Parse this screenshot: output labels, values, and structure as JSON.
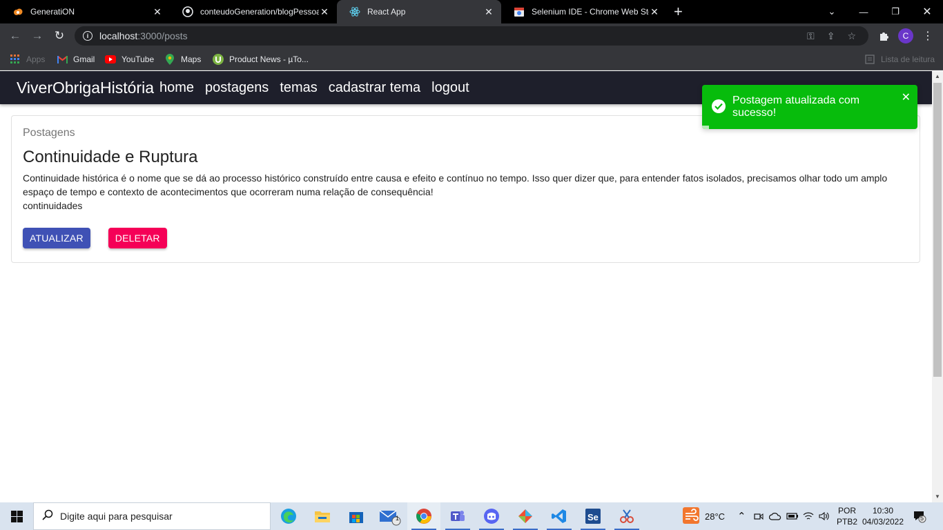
{
  "browser": {
    "tabs": [
      {
        "title": "GeneratiON",
        "favicon": "cloud-icon",
        "active": false
      },
      {
        "title": "conteudoGeneration/blogPessoal",
        "favicon": "github-icon",
        "active": false
      },
      {
        "title": "React App",
        "favicon": "react-icon",
        "active": true
      },
      {
        "title": "Selenium IDE - Chrome Web Store",
        "favicon": "webstore-icon",
        "active": false
      }
    ],
    "url_host": "localhost",
    "url_path": ":3000/posts",
    "profile_initial": "C",
    "bookmarks": [
      {
        "label": "Apps",
        "icon": "apps-grid-icon"
      },
      {
        "label": "Gmail",
        "icon": "gmail-icon"
      },
      {
        "label": "YouTube",
        "icon": "youtube-icon"
      },
      {
        "label": "Maps",
        "icon": "maps-icon"
      },
      {
        "label": "Product News - µTo...",
        "icon": "utorrent-icon"
      }
    ],
    "reading_list": "Lista de leitura"
  },
  "app": {
    "brand": "ViverObrigaHistória",
    "nav": [
      "home",
      "postagens",
      "temas",
      "cadastrar tema",
      "logout"
    ]
  },
  "post": {
    "overline": "Postagens",
    "title": "Continuidade e Ruptura",
    "text": "Continuidade histórica é o nome que se dá ao processo histórico construído entre causa e efeito e contínuo no tempo. Isso quer dizer que, para entender fatos isolados, precisamos olhar todo um amplo espaço de tempo e contexto de acontecimentos que ocorreram numa relação de consequência!",
    "theme": "continuidades",
    "update_label": "Atualizar",
    "delete_label": "Deletar"
  },
  "toast": {
    "message": "Postagem atualizada com sucesso!",
    "color": "#07bc0c"
  },
  "taskbar": {
    "search_placeholder": "Digite aqui para pesquisar",
    "weather": "28°C",
    "lang_top": "POR",
    "lang_bottom": "PTB2",
    "time": "10:30",
    "date": "04/03/2022",
    "mail_badge": "1",
    "notif_badge": "5"
  },
  "colors": {
    "appbar": "#1e1f2b",
    "primary": "#3f51b5",
    "secondary": "#f50057"
  }
}
